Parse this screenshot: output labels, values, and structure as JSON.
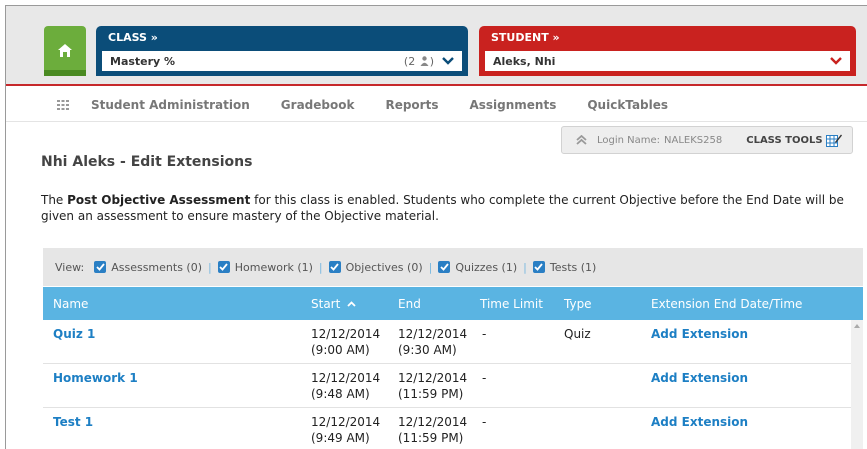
{
  "header": {
    "class_title": "CLASS »",
    "class_select": "Mastery %",
    "class_count": "(2",
    "student_title": "STUDENT »",
    "student_select": "Aleks, Nhi"
  },
  "nav": {
    "items": [
      {
        "label": "Student Administration"
      },
      {
        "label": "Gradebook"
      },
      {
        "label": "Reports"
      },
      {
        "label": "Assignments"
      },
      {
        "label": "QuickTables"
      }
    ]
  },
  "login": {
    "label": "Login Name:",
    "name": "NALEKS258",
    "tools": "CLASS TOOLS"
  },
  "page": {
    "title": "Nhi Aleks - Edit Extensions",
    "notice_pre": "The ",
    "notice_bold": "Post Objective Assessment",
    "notice_post": " for this class is enabled. Students who complete the current Objective before the End Date will be given an assessment to ensure mastery of the Objective material."
  },
  "view": {
    "label": "View:",
    "filters": [
      {
        "label": "Assessments (0)"
      },
      {
        "label": "Homework (1)"
      },
      {
        "label": "Objectives (0)"
      },
      {
        "label": "Quizzes (1)"
      },
      {
        "label": "Tests (1)"
      }
    ]
  },
  "table": {
    "columns": {
      "name": "Name",
      "start": "Start",
      "end": "End",
      "time_limit": "Time Limit",
      "type": "Type",
      "extension": "Extension End Date/Time"
    },
    "rows": [
      {
        "name": "Quiz 1",
        "start_date": "12/12/2014",
        "start_time": "(9:00 AM)",
        "end_date": "12/12/2014",
        "end_time": "(9:30 AM)",
        "time_limit": "-",
        "type": "Quiz",
        "extension": "Add Extension"
      },
      {
        "name": "Homework 1",
        "start_date": "12/12/2014",
        "start_time": "(9:48 AM)",
        "end_date": "12/12/2014",
        "end_time": "(11:59 PM)",
        "time_limit": "-",
        "type": "",
        "extension": "Add Extension"
      },
      {
        "name": "Test 1",
        "start_date": "12/12/2014",
        "start_time": "(9:49 AM)",
        "end_date": "12/12/2014",
        "end_time": "(11:59 PM)",
        "time_limit": "-",
        "type": "",
        "extension": "Add Extension"
      }
    ]
  },
  "colors": {
    "class_panel": "#0b4d79",
    "student_panel": "#c9221f",
    "home": "#6cad3c",
    "table_header": "#5ab4e2",
    "link": "#1d7fc4"
  }
}
